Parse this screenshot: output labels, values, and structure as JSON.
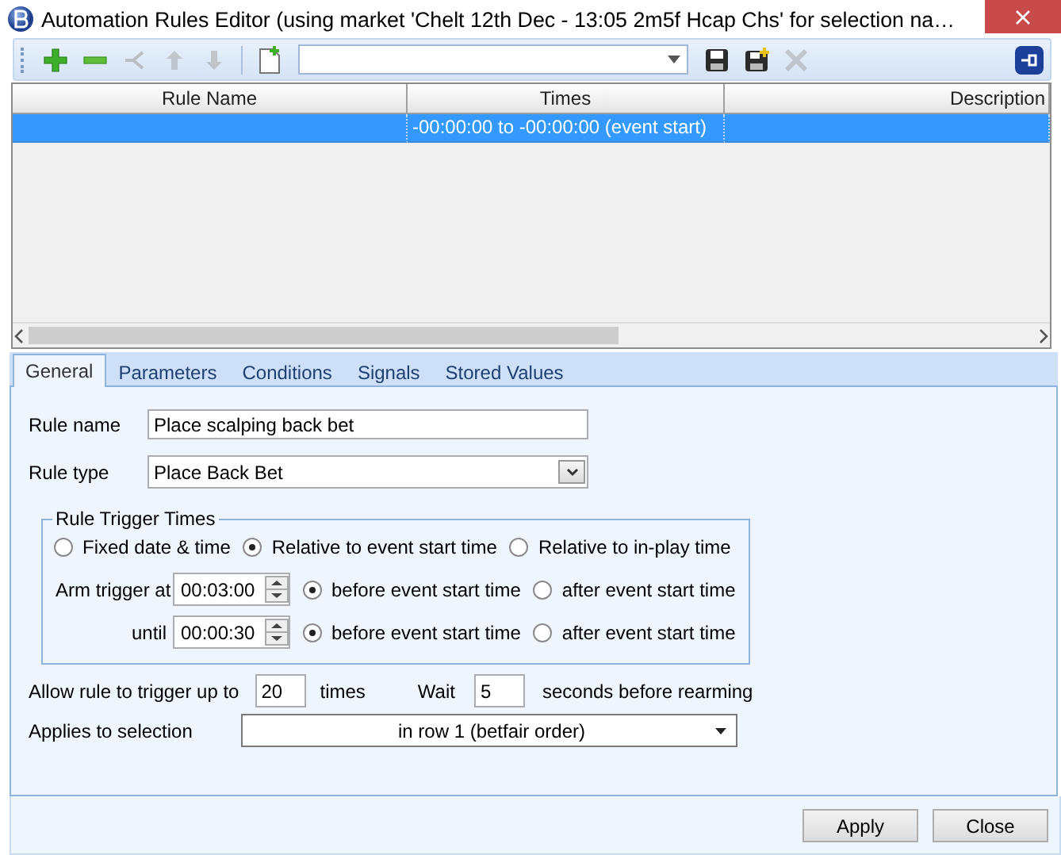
{
  "window": {
    "title": "Automation Rules Editor (using market 'Chelt 12th Dec - 13:05 2m5f Hcap Chs' for selection na…"
  },
  "toolbar": {
    "buttons": [
      {
        "kind": "add",
        "disabled": false
      },
      {
        "kind": "remove",
        "disabled": false
      },
      {
        "kind": "branch",
        "disabled": true
      },
      {
        "kind": "up",
        "disabled": true
      },
      {
        "kind": "down",
        "disabled": true
      },
      {
        "kind": "new",
        "disabled": false
      },
      {
        "kind": "combo"
      },
      {
        "kind": "save",
        "disabled": false
      },
      {
        "kind": "saveas",
        "disabled": false
      },
      {
        "kind": "delete",
        "disabled": true
      }
    ]
  },
  "grid": {
    "columns": [
      "Rule Name",
      "Times",
      "Description"
    ],
    "rows": [
      {
        "times": "-00:00:00 to -00:00:00 (event start)",
        "selected": true
      }
    ]
  },
  "tabs": [
    {
      "label": "General",
      "selected": true
    },
    {
      "label": "Parameters",
      "selected": false
    },
    {
      "label": "Conditions",
      "selected": false
    },
    {
      "label": "Signals",
      "selected": false
    },
    {
      "label": "Stored Values",
      "selected": false
    }
  ],
  "general": {
    "rule_name": {
      "label": "Rule name",
      "value": "Place scalping back bet"
    },
    "rule_type": {
      "label": "Rule type",
      "value": "Place Back Bet"
    },
    "trigger_times": {
      "title": "Rule Trigger Times",
      "modes": [
        {
          "label": "Fixed date & time",
          "selected": false
        },
        {
          "label": "Relative to event start time",
          "selected": true
        },
        {
          "label": "Relative to in-play time",
          "selected": false
        }
      ],
      "rows": [
        {
          "label": "Arm trigger at",
          "value": "00:03:00",
          "options": [
            {
              "label": "before event start time",
              "selected": true
            },
            {
              "label": "after event start time",
              "selected": false
            }
          ]
        },
        {
          "label": "until",
          "value": "00:00:30",
          "options": [
            {
              "label": "before event start time",
              "selected": true
            },
            {
              "label": "after event start time",
              "selected": false
            }
          ]
        }
      ]
    },
    "allow": {
      "label": "Allow rule to trigger up to",
      "value": "20",
      "suffix": "times"
    },
    "wait": {
      "label": "Wait",
      "value": "5",
      "suffix": "seconds before rearming"
    },
    "applies": {
      "label": "Applies to selection",
      "value": "in row 1 (betfair order)"
    }
  },
  "buttons": [
    "Apply",
    "Close"
  ]
}
